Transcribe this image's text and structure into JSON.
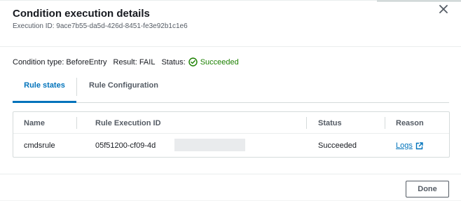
{
  "modal": {
    "title": "Condition execution details",
    "execution_id_text": "Execution ID: 9ace7b55-da5d-426d-8451-fe3e92b1c1e6",
    "close_icon": "close-icon"
  },
  "summary": {
    "condition_type_text": "Condition type: BeforeEntry",
    "result_text": "Result: FAIL",
    "status_label": "Status:",
    "status_value": "Succeeded",
    "status_icon": "check-circle-icon",
    "status_color": "#1d8102"
  },
  "tabs": [
    {
      "label": "Rule states",
      "active": true
    },
    {
      "label": "Rule Configuration",
      "active": false
    }
  ],
  "table": {
    "headers": [
      "Name",
      "Rule Execution ID",
      "Status",
      "Reason"
    ],
    "rows": [
      {
        "name": "cmdsrule",
        "rule_execution_id": "05f51200-cf09-4d",
        "status": "Succeeded",
        "reason_link": "Logs",
        "reason_icon": "external-link-icon"
      }
    ]
  },
  "footer": {
    "done_label": "Done"
  },
  "colors": {
    "accent": "#0073bb",
    "success": "#1d8102",
    "text": "#16191f",
    "muted": "#545b64"
  }
}
